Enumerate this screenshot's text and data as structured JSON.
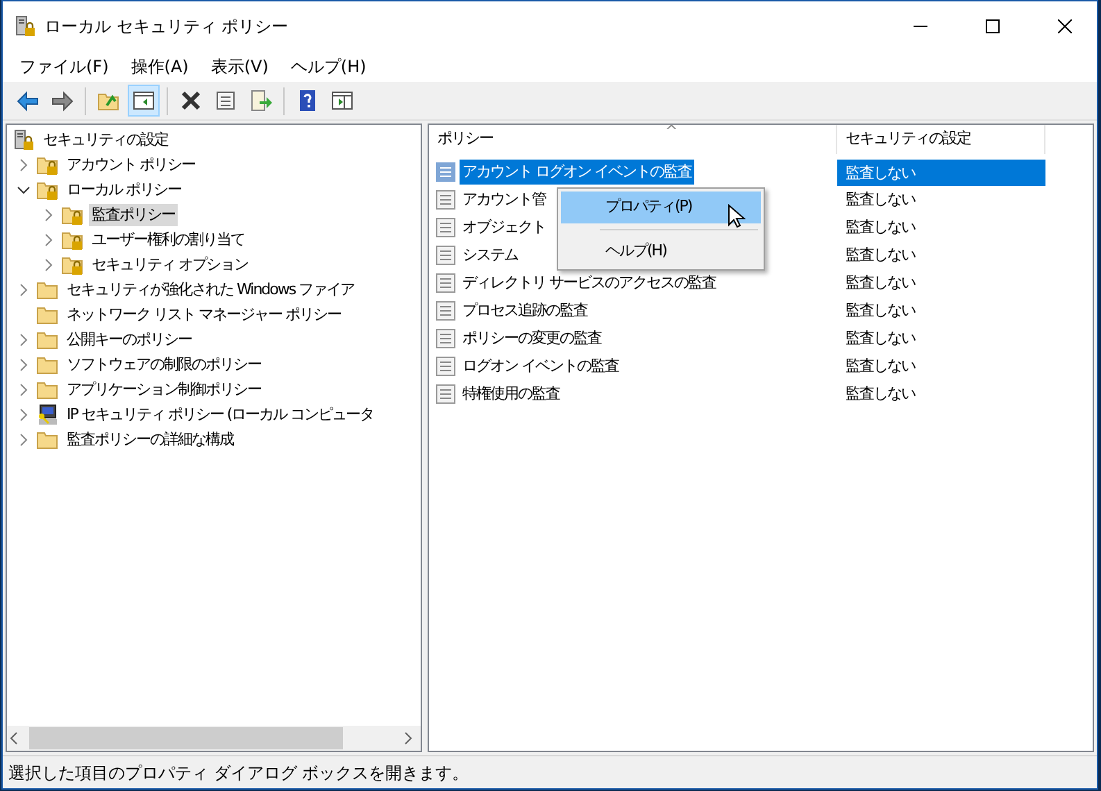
{
  "window": {
    "title": "ローカル セキュリティ ポリシー"
  },
  "menu": [
    "ファイル(F)",
    "操作(A)",
    "表示(V)",
    "ヘルプ(H)"
  ],
  "toolbar": [
    {
      "kind": "back",
      "pressed": false
    },
    {
      "kind": "forward",
      "pressed": false
    },
    {
      "kind": "sep"
    },
    {
      "kind": "up",
      "pressed": false
    },
    {
      "kind": "tree",
      "pressed": true
    },
    {
      "kind": "sep"
    },
    {
      "kind": "delete",
      "pressed": false
    },
    {
      "kind": "properties",
      "pressed": false
    },
    {
      "kind": "export",
      "pressed": false
    },
    {
      "kind": "sep"
    },
    {
      "kind": "help",
      "pressed": false
    },
    {
      "kind": "panel",
      "pressed": false
    }
  ],
  "tree": [
    {
      "label": "セキュリティの設定",
      "kind": "root",
      "selected": false,
      "children": [
        {
          "label": "アカウント ポリシー",
          "kind": "lockfolder",
          "expanded": false,
          "selected": false
        },
        {
          "label": "ローカル ポリシー",
          "kind": "lockfolder",
          "expanded": true,
          "selected": false,
          "children": [
            {
              "label": "監査ポリシー",
              "kind": "lockfolder",
              "expanded": false,
              "selected": true
            },
            {
              "label": "ユーザー権利の割り当て",
              "kind": "lockfolder",
              "expanded": false,
              "selected": false
            },
            {
              "label": "セキュリティ オプション",
              "kind": "lockfolder",
              "expanded": false,
              "selected": false
            }
          ]
        },
        {
          "label": "セキュリティが強化された Windows ファイア",
          "kind": "folder",
          "expanded": false,
          "selected": false
        },
        {
          "label": "ネットワーク リスト マネージャー ポリシー",
          "kind": "folder",
          "selected": false
        },
        {
          "label": "公開キーのポリシー",
          "kind": "folder",
          "expanded": false,
          "selected": false
        },
        {
          "label": "ソフトウェアの制限のポリシー",
          "kind": "folder",
          "expanded": false,
          "selected": false
        },
        {
          "label": "アプリケーション制御ポリシー",
          "kind": "folder",
          "expanded": false,
          "selected": false
        },
        {
          "label": "IP セキュリティ ポリシー (ローカル コンピュータ",
          "kind": "ip",
          "expanded": false,
          "selected": false
        },
        {
          "label": "監査ポリシーの詳細な構成",
          "kind": "folder",
          "expanded": false,
          "selected": false
        }
      ]
    }
  ],
  "table": {
    "columns": [
      "ポリシー",
      "セキュリティの設定"
    ],
    "sort_arrow": "^",
    "rows": [
      {
        "policy": "アカウント ログオン イベントの監査",
        "setting": "監査しない",
        "selected": true
      },
      {
        "policy": "アカウント管",
        "setting": "監査しない",
        "selected": false
      },
      {
        "policy": "オブジェクト",
        "setting": "監査しない",
        "selected": false
      },
      {
        "policy": "システム",
        "setting": "監査しない",
        "selected": false
      },
      {
        "policy": "ディレクトリ サービスのアクセスの監査",
        "setting": "監査しない",
        "selected": false
      },
      {
        "policy": "プロセス追跡の監査",
        "setting": "監査しない",
        "selected": false
      },
      {
        "policy": "ポリシーの変更の監査",
        "setting": "監査しない",
        "selected": false
      },
      {
        "policy": "ログオン イベントの監査",
        "setting": "監査しない",
        "selected": false
      },
      {
        "policy": "特権使用の監査",
        "setting": "監査しない",
        "selected": false
      }
    ]
  },
  "context_menu": [
    {
      "kind": "item",
      "label": "プロパティ(P)",
      "selected": true
    },
    {
      "kind": "separator"
    },
    {
      "kind": "item",
      "label": "ヘルプ(H)",
      "selected": false
    }
  ],
  "status_bar": "選択した項目のプロパティ ダイアログ ボックスを開きます。"
}
